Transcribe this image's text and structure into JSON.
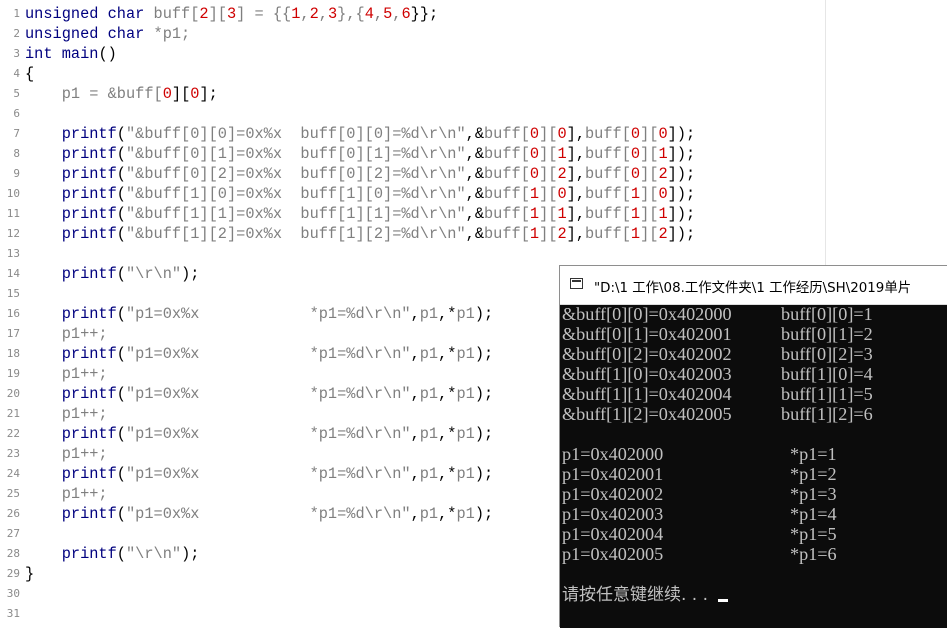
{
  "editor": {
    "line_numbers": [
      "1",
      "2",
      "3",
      "4",
      "5",
      "6",
      "7",
      "8",
      "9",
      "10",
      "11",
      "12",
      "13",
      "14",
      "15",
      "16",
      "17",
      "18",
      "19",
      "20",
      "21",
      "22",
      "23",
      "24",
      "25",
      "26",
      "27",
      "28",
      "29",
      "30",
      "31"
    ],
    "lines": [
      [
        {
          "t": "unsigned",
          "c": "k"
        },
        {
          "t": " ",
          "c": "o"
        },
        {
          "t": "char",
          "c": "k"
        },
        {
          "t": " buff[",
          "c": "v"
        },
        {
          "t": "2",
          "c": "n"
        },
        {
          "t": "][",
          "c": "v"
        },
        {
          "t": "3",
          "c": "n"
        },
        {
          "t": "] = {{",
          "c": "v"
        },
        {
          "t": "1",
          "c": "n"
        },
        {
          "t": ",",
          "c": "v"
        },
        {
          "t": "2",
          "c": "n"
        },
        {
          "t": ",",
          "c": "v"
        },
        {
          "t": "3",
          "c": "n"
        },
        {
          "t": "},{",
          "c": "v"
        },
        {
          "t": "4",
          "c": "n"
        },
        {
          "t": ",",
          "c": "v"
        },
        {
          "t": "5",
          "c": "n"
        },
        {
          "t": ",",
          "c": "v"
        },
        {
          "t": "6",
          "c": "n"
        },
        {
          "t": "}};",
          "c": "o"
        }
      ],
      [
        {
          "t": "unsigned",
          "c": "k"
        },
        {
          "t": " ",
          "c": "o"
        },
        {
          "t": "char",
          "c": "k"
        },
        {
          "t": " *p1;",
          "c": "v"
        }
      ],
      [
        {
          "t": "int",
          "c": "k"
        },
        {
          "t": " ",
          "c": "o"
        },
        {
          "t": "main",
          "c": "fn"
        },
        {
          "t": "()",
          "c": "o"
        }
      ],
      [
        {
          "t": "{",
          "c": "o"
        }
      ],
      [
        {
          "t": "    p1 = &buff[",
          "c": "v"
        },
        {
          "t": "0",
          "c": "n"
        },
        {
          "t": "][",
          "c": "o"
        },
        {
          "t": "0",
          "c": "n"
        },
        {
          "t": "];",
          "c": "o"
        }
      ],
      [],
      [
        {
          "t": "    ",
          "c": "o"
        },
        {
          "t": "printf",
          "c": "fn"
        },
        {
          "t": "(",
          "c": "o"
        },
        {
          "t": "\"&buff[0][0]=0x%x  buff[0][0]=%d\\r\\n\"",
          "c": "s"
        },
        {
          "t": ",&",
          "c": "o"
        },
        {
          "t": "buff[",
          "c": "v"
        },
        {
          "t": "0",
          "c": "n"
        },
        {
          "t": "][",
          "c": "v"
        },
        {
          "t": "0",
          "c": "n"
        },
        {
          "t": "],",
          "c": "o"
        },
        {
          "t": "buff[",
          "c": "v"
        },
        {
          "t": "0",
          "c": "n"
        },
        {
          "t": "][",
          "c": "v"
        },
        {
          "t": "0",
          "c": "n"
        },
        {
          "t": "]);",
          "c": "o"
        }
      ],
      [
        {
          "t": "    ",
          "c": "o"
        },
        {
          "t": "printf",
          "c": "fn"
        },
        {
          "t": "(",
          "c": "o"
        },
        {
          "t": "\"&buff[0][1]=0x%x  buff[0][1]=%d\\r\\n\"",
          "c": "s"
        },
        {
          "t": ",&",
          "c": "o"
        },
        {
          "t": "buff[",
          "c": "v"
        },
        {
          "t": "0",
          "c": "n"
        },
        {
          "t": "][",
          "c": "v"
        },
        {
          "t": "1",
          "c": "n"
        },
        {
          "t": "],",
          "c": "o"
        },
        {
          "t": "buff[",
          "c": "v"
        },
        {
          "t": "0",
          "c": "n"
        },
        {
          "t": "][",
          "c": "v"
        },
        {
          "t": "1",
          "c": "n"
        },
        {
          "t": "]);",
          "c": "o"
        }
      ],
      [
        {
          "t": "    ",
          "c": "o"
        },
        {
          "t": "printf",
          "c": "fn"
        },
        {
          "t": "(",
          "c": "o"
        },
        {
          "t": "\"&buff[0][2]=0x%x  buff[0][2]=%d\\r\\n\"",
          "c": "s"
        },
        {
          "t": ",&",
          "c": "o"
        },
        {
          "t": "buff[",
          "c": "v"
        },
        {
          "t": "0",
          "c": "n"
        },
        {
          "t": "][",
          "c": "v"
        },
        {
          "t": "2",
          "c": "n"
        },
        {
          "t": "],",
          "c": "o"
        },
        {
          "t": "buff[",
          "c": "v"
        },
        {
          "t": "0",
          "c": "n"
        },
        {
          "t": "][",
          "c": "v"
        },
        {
          "t": "2",
          "c": "n"
        },
        {
          "t": "]);",
          "c": "o"
        }
      ],
      [
        {
          "t": "    ",
          "c": "o"
        },
        {
          "t": "printf",
          "c": "fn"
        },
        {
          "t": "(",
          "c": "o"
        },
        {
          "t": "\"&buff[1][0]=0x%x  buff[1][0]=%d\\r\\n\"",
          "c": "s"
        },
        {
          "t": ",&",
          "c": "o"
        },
        {
          "t": "buff[",
          "c": "v"
        },
        {
          "t": "1",
          "c": "n"
        },
        {
          "t": "][",
          "c": "v"
        },
        {
          "t": "0",
          "c": "n"
        },
        {
          "t": "],",
          "c": "o"
        },
        {
          "t": "buff[",
          "c": "v"
        },
        {
          "t": "1",
          "c": "n"
        },
        {
          "t": "][",
          "c": "v"
        },
        {
          "t": "0",
          "c": "n"
        },
        {
          "t": "]);",
          "c": "o"
        }
      ],
      [
        {
          "t": "    ",
          "c": "o"
        },
        {
          "t": "printf",
          "c": "fn"
        },
        {
          "t": "(",
          "c": "o"
        },
        {
          "t": "\"&buff[1][1]=0x%x  buff[1][1]=%d\\r\\n\"",
          "c": "s"
        },
        {
          "t": ",&",
          "c": "o"
        },
        {
          "t": "buff[",
          "c": "v"
        },
        {
          "t": "1",
          "c": "n"
        },
        {
          "t": "][",
          "c": "v"
        },
        {
          "t": "1",
          "c": "n"
        },
        {
          "t": "],",
          "c": "o"
        },
        {
          "t": "buff[",
          "c": "v"
        },
        {
          "t": "1",
          "c": "n"
        },
        {
          "t": "][",
          "c": "v"
        },
        {
          "t": "1",
          "c": "n"
        },
        {
          "t": "]);",
          "c": "o"
        }
      ],
      [
        {
          "t": "    ",
          "c": "o"
        },
        {
          "t": "printf",
          "c": "fn"
        },
        {
          "t": "(",
          "c": "o"
        },
        {
          "t": "\"&buff[1][2]=0x%x  buff[1][2]=%d\\r\\n\"",
          "c": "s"
        },
        {
          "t": ",&",
          "c": "o"
        },
        {
          "t": "buff[",
          "c": "v"
        },
        {
          "t": "1",
          "c": "n"
        },
        {
          "t": "][",
          "c": "v"
        },
        {
          "t": "2",
          "c": "n"
        },
        {
          "t": "],",
          "c": "o"
        },
        {
          "t": "buff[",
          "c": "v"
        },
        {
          "t": "1",
          "c": "n"
        },
        {
          "t": "][",
          "c": "v"
        },
        {
          "t": "2",
          "c": "n"
        },
        {
          "t": "]);",
          "c": "o"
        }
      ],
      [],
      [
        {
          "t": "    ",
          "c": "o"
        },
        {
          "t": "printf",
          "c": "fn"
        },
        {
          "t": "(",
          "c": "o"
        },
        {
          "t": "\"\\r\\n\"",
          "c": "s"
        },
        {
          "t": ");",
          "c": "o"
        }
      ],
      [],
      [
        {
          "t": "    ",
          "c": "o"
        },
        {
          "t": "printf",
          "c": "fn"
        },
        {
          "t": "(",
          "c": "o"
        },
        {
          "t": "\"p1=0x%x            *p1=%d\\r\\n\"",
          "c": "s"
        },
        {
          "t": ",",
          "c": "o"
        },
        {
          "t": "p1",
          "c": "v"
        },
        {
          "t": ",*",
          "c": "o"
        },
        {
          "t": "p1",
          "c": "v"
        },
        {
          "t": ");",
          "c": "o"
        }
      ],
      [
        {
          "t": "    p1++;",
          "c": "v"
        }
      ],
      [
        {
          "t": "    ",
          "c": "o"
        },
        {
          "t": "printf",
          "c": "fn"
        },
        {
          "t": "(",
          "c": "o"
        },
        {
          "t": "\"p1=0x%x            *p1=%d\\r\\n\"",
          "c": "s"
        },
        {
          "t": ",",
          "c": "o"
        },
        {
          "t": "p1",
          "c": "v"
        },
        {
          "t": ",*",
          "c": "o"
        },
        {
          "t": "p1",
          "c": "v"
        },
        {
          "t": ");",
          "c": "o"
        }
      ],
      [
        {
          "t": "    p1++;",
          "c": "v"
        }
      ],
      [
        {
          "t": "    ",
          "c": "o"
        },
        {
          "t": "printf",
          "c": "fn"
        },
        {
          "t": "(",
          "c": "o"
        },
        {
          "t": "\"p1=0x%x            *p1=%d\\r\\n\"",
          "c": "s"
        },
        {
          "t": ",",
          "c": "o"
        },
        {
          "t": "p1",
          "c": "v"
        },
        {
          "t": ",*",
          "c": "o"
        },
        {
          "t": "p1",
          "c": "v"
        },
        {
          "t": ");",
          "c": "o"
        }
      ],
      [
        {
          "t": "    p1++;",
          "c": "v"
        }
      ],
      [
        {
          "t": "    ",
          "c": "o"
        },
        {
          "t": "printf",
          "c": "fn"
        },
        {
          "t": "(",
          "c": "o"
        },
        {
          "t": "\"p1=0x%x            *p1=%d\\r\\n\"",
          "c": "s"
        },
        {
          "t": ",",
          "c": "o"
        },
        {
          "t": "p1",
          "c": "v"
        },
        {
          "t": ",*",
          "c": "o"
        },
        {
          "t": "p1",
          "c": "v"
        },
        {
          "t": ");",
          "c": "o"
        }
      ],
      [
        {
          "t": "    p1++;",
          "c": "v"
        }
      ],
      [
        {
          "t": "    ",
          "c": "o"
        },
        {
          "t": "printf",
          "c": "fn"
        },
        {
          "t": "(",
          "c": "o"
        },
        {
          "t": "\"p1=0x%x            *p1=%d\\r\\n\"",
          "c": "s"
        },
        {
          "t": ",",
          "c": "o"
        },
        {
          "t": "p1",
          "c": "v"
        },
        {
          "t": ",*",
          "c": "o"
        },
        {
          "t": "p1",
          "c": "v"
        },
        {
          "t": ");",
          "c": "o"
        }
      ],
      [
        {
          "t": "    p1++;",
          "c": "v"
        }
      ],
      [
        {
          "t": "    ",
          "c": "o"
        },
        {
          "t": "printf",
          "c": "fn"
        },
        {
          "t": "(",
          "c": "o"
        },
        {
          "t": "\"p1=0x%x            *p1=%d\\r\\n\"",
          "c": "s"
        },
        {
          "t": ",",
          "c": "o"
        },
        {
          "t": "p1",
          "c": "v"
        },
        {
          "t": ",*",
          "c": "o"
        },
        {
          "t": "p1",
          "c": "v"
        },
        {
          "t": ");",
          "c": "o"
        }
      ],
      [],
      [
        {
          "t": "    ",
          "c": "o"
        },
        {
          "t": "printf",
          "c": "fn"
        },
        {
          "t": "(",
          "c": "o"
        },
        {
          "t": "\"\\r\\n\"",
          "c": "s"
        },
        {
          "t": ");",
          "c": "o"
        }
      ],
      [
        {
          "t": "}",
          "c": "o"
        }
      ],
      [],
      []
    ]
  },
  "console": {
    "title": "\"D:\\1 工作\\08.工作文件夹\\1 工作经历\\SH\\2019单片",
    "colors": {
      "background": "#0c0c0c",
      "text": "#c0c0c0",
      "titlebar": "#ffffff"
    },
    "output": [
      {
        "a": "&buff[0][0]=0x402000",
        "b": "buff[0][0]=1"
      },
      {
        "a": "&buff[0][1]=0x402001",
        "b": "buff[0][1]=2"
      },
      {
        "a": "&buff[0][2]=0x402002",
        "b": "buff[0][2]=3"
      },
      {
        "a": "&buff[1][0]=0x402003",
        "b": "buff[1][0]=4"
      },
      {
        "a": "&buff[1][1]=0x402004",
        "b": "buff[1][1]=5"
      },
      {
        "a": "&buff[1][2]=0x402005",
        "b": "buff[1][2]=6"
      },
      {
        "a": "",
        "b": ""
      },
      {
        "a": "p1=0x402000",
        "b": "*p1=1"
      },
      {
        "a": "p1=0x402001",
        "b": "*p1=2"
      },
      {
        "a": "p1=0x402002",
        "b": "*p1=3"
      },
      {
        "a": "p1=0x402003",
        "b": "*p1=4"
      },
      {
        "a": "p1=0x402004",
        "b": "*p1=5"
      },
      {
        "a": "p1=0x402005",
        "b": "*p1=6"
      },
      {
        "a": "",
        "b": ""
      }
    ],
    "prompt": "请按任意键继续. . ."
  }
}
